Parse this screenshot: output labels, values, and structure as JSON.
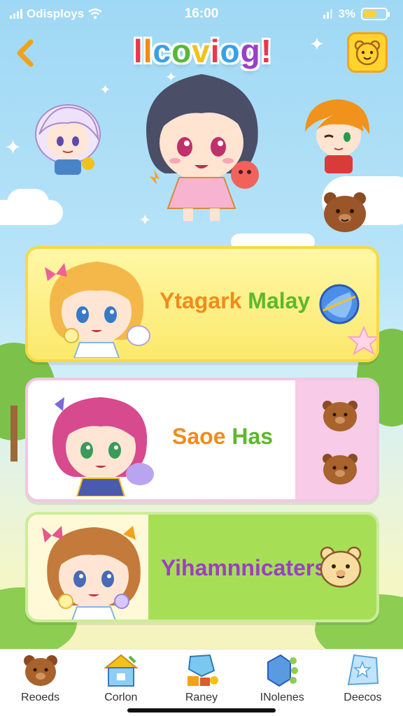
{
  "status_bar": {
    "carrier": "Odisploys",
    "time": "16:00",
    "battery": "3%"
  },
  "header": {
    "back_icon": "chevron-left-icon",
    "title_letters": [
      "l",
      "l",
      "c",
      "o",
      "v",
      "i",
      "o",
      "g",
      "!"
    ],
    "title_colors": [
      "#e8394a",
      "#f08c1a",
      "#3aa0e6",
      "#57b83a",
      "#f2c21c",
      "#e8394a",
      "#3aa0e6",
      "#9b3fc4",
      "#e8394a"
    ],
    "corner_icon": "bear-face-icon"
  },
  "cards": [
    {
      "label_parts": [
        "Ytagark ",
        "Malay"
      ],
      "label_colors": [
        "#f08c1a",
        "#5cb82c"
      ],
      "icon": "globe-orb-icon"
    },
    {
      "label_parts": [
        "Saoe ",
        "Has"
      ],
      "label_colors": [
        "#f08c1a",
        "#5cb82c"
      ],
      "icon": "bear-icon"
    },
    {
      "label_parts": [
        "Yihamnnicaters"
      ],
      "label_colors": [
        "#9b3fc4"
      ],
      "icon": "bear-face-icon"
    }
  ],
  "bottom_nav": [
    {
      "label": "Reoeds",
      "icon": "bear-icon"
    },
    {
      "label": "Corlon",
      "icon": "house-icon"
    },
    {
      "label": "Raney",
      "icon": "crystal-icon"
    },
    {
      "label": "INolenes",
      "icon": "gem-icon"
    },
    {
      "label": "Deecos",
      "icon": "star-tile-icon"
    }
  ],
  "colors": {
    "sky": "#9fd8f5",
    "accent_yellow": "#ffd42e",
    "card1": "#fbe96b",
    "card2_side": "#f8cbe8",
    "card3": "#a6df56"
  }
}
